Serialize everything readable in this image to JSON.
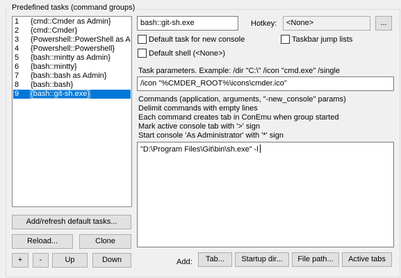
{
  "group": {
    "title": "Predefined tasks (command groups)"
  },
  "tasks": [
    {
      "num": "1",
      "name": "{cmd::Cmder as Admin}"
    },
    {
      "num": "2",
      "name": "{cmd::Cmder}"
    },
    {
      "num": "3",
      "name": "{Powershell::PowerShell as Ad"
    },
    {
      "num": "4",
      "name": "{Powershell::Powershell}"
    },
    {
      "num": "5",
      "name": "{bash::mintty as Admin}"
    },
    {
      "num": "6",
      "name": "{bash::mintty}"
    },
    {
      "num": "7",
      "name": "{bash::bash as Admin}"
    },
    {
      "num": "8",
      "name": "{bash::bash}"
    },
    {
      "num": "9",
      "name": "{bash::git-sh.exe}"
    }
  ],
  "selected_task_index": 8,
  "left_buttons": {
    "add_refresh": "Add/refresh default tasks...",
    "reload": "Reload...",
    "clone": "Clone",
    "plus": "+",
    "minus": "-",
    "up": "Up",
    "down": "Down"
  },
  "task_name_value": "bash::git-sh.exe",
  "hotkey": {
    "label": "Hotkey:",
    "value": "<None>",
    "browse": "..."
  },
  "checkboxes": {
    "default_task": {
      "label": "Default task for new console",
      "checked": false
    },
    "taskbar_jump": {
      "label": "Taskbar jump lists",
      "checked": false
    },
    "default_shell": {
      "label": "Default shell (<None>)",
      "checked": false
    }
  },
  "task_params": {
    "label": "Task parameters. Example: /dir \"C:\\\" /icon \"cmd.exe\" /single",
    "value": "/icon \"%CMDER_ROOT%\\icons\\cmder.ico\""
  },
  "commands_help": [
    "Commands (application, arguments, \"-new_console\" params)",
    "Delimit commands with empty lines",
    "Each command creates tab in ConEmu when group started",
    "Mark active console tab with '>' sign",
    "Start console 'As Administrator' with '*' sign"
  ],
  "commands_value": "\"D:\\Program Files\\Git\\bin\\sh.exe\" -l",
  "add_row": {
    "label": "Add:",
    "tab": "Tab...",
    "startup_dir": "Startup dir...",
    "file_path": "File path...",
    "active_tabs": "Active tabs"
  }
}
